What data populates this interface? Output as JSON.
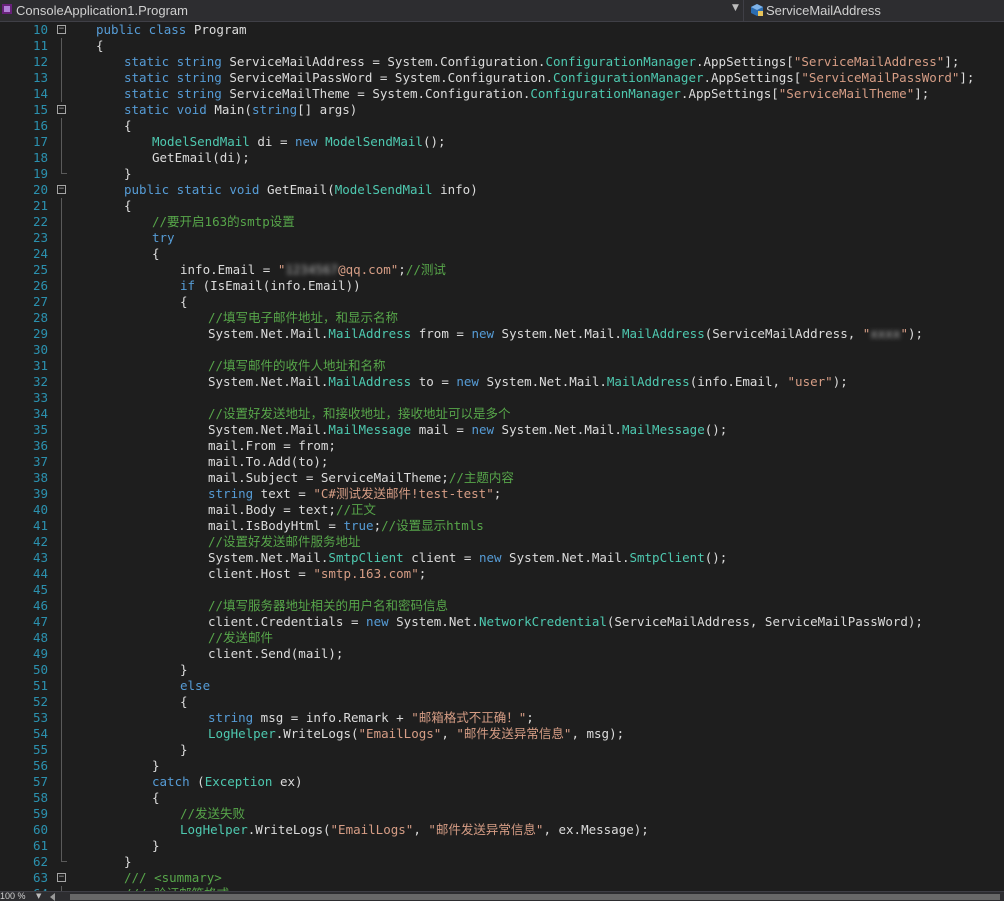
{
  "navigation_bar": {
    "type_selector": "ConsoleApplication1.Program",
    "member_selector": "ServiceMailAddress"
  },
  "status_bar": {
    "zoom": "100 %"
  },
  "colors": {
    "keyword": "#569cd6",
    "type": "#4ec9b0",
    "string": "#d69d85",
    "comment": "#57a64a",
    "line_number": "#2b91af",
    "text": "#dcdcdc",
    "background": "#1e1e1e"
  },
  "code_lines": [
    {
      "n": "10",
      "fold": "minus",
      "t": [
        [
          "kw",
          "public class"
        ],
        [
          "p",
          " Program"
        ]
      ]
    },
    {
      "n": "11",
      "fold": "line",
      "t": [
        [
          "p",
          "{"
        ]
      ]
    },
    {
      "n": "12",
      "fold": "line",
      "t": [
        [
          "kw",
          "static string"
        ],
        [
          "p",
          " ServiceMailAddress = System.Configuration."
        ],
        [
          "ty",
          "ConfigurationManager"
        ],
        [
          "p",
          ".AppSettings["
        ],
        [
          "str",
          "\"ServiceMailAddress\""
        ],
        [
          "p",
          "];"
        ]
      ]
    },
    {
      "n": "13",
      "fold": "line",
      "t": [
        [
          "kw",
          "static string"
        ],
        [
          "p",
          " ServiceMailPassWord = System.Configuration."
        ],
        [
          "ty",
          "ConfigurationManager"
        ],
        [
          "p",
          ".AppSettings["
        ],
        [
          "str",
          "\"ServiceMailPassWord\""
        ],
        [
          "p",
          "];"
        ]
      ]
    },
    {
      "n": "14",
      "fold": "line",
      "t": [
        [
          "kw",
          "static string"
        ],
        [
          "p",
          " ServiceMailTheme = System.Configuration."
        ],
        [
          "ty",
          "ConfigurationManager"
        ],
        [
          "p",
          ".AppSettings["
        ],
        [
          "str",
          "\"ServiceMailTheme\""
        ],
        [
          "p",
          "];"
        ]
      ]
    },
    {
      "n": "15",
      "fold": "minus",
      "t": [
        [
          "kw",
          "static void"
        ],
        [
          "p",
          " Main("
        ],
        [
          "kw",
          "string"
        ],
        [
          "p",
          "[] args)"
        ]
      ]
    },
    {
      "n": "16",
      "fold": "line",
      "t": [
        [
          "p",
          "{"
        ]
      ]
    },
    {
      "n": "17",
      "fold": "line",
      "t": [
        [
          "ty",
          "ModelSendMail"
        ],
        [
          "p",
          " di = "
        ],
        [
          "kw",
          "new"
        ],
        [
          "p",
          " "
        ],
        [
          "ty",
          "ModelSendMail"
        ],
        [
          "p",
          "();"
        ]
      ]
    },
    {
      "n": "18",
      "fold": "line",
      "t": [
        [
          "p",
          "GetEmail(di);"
        ]
      ]
    },
    {
      "n": "19",
      "fold": "end",
      "t": [
        [
          "p",
          "}"
        ]
      ]
    },
    {
      "n": "20",
      "fold": "minus",
      "t": [
        [
          "kw",
          "public static void"
        ],
        [
          "p",
          " GetEmail("
        ],
        [
          "ty",
          "ModelSendMail"
        ],
        [
          "p",
          " info)"
        ]
      ]
    },
    {
      "n": "21",
      "fold": "line",
      "t": [
        [
          "p",
          "{"
        ]
      ]
    },
    {
      "n": "22",
      "fold": "line",
      "t": [
        [
          "cm",
          "//要开启163的smtp设置"
        ]
      ]
    },
    {
      "n": "23",
      "fold": "line",
      "t": [
        [
          "kw",
          "try"
        ]
      ]
    },
    {
      "n": "24",
      "fold": "line",
      "t": [
        [
          "p",
          "{"
        ]
      ]
    },
    {
      "n": "25",
      "fold": "line",
      "t": [
        [
          "p",
          "info.Email = "
        ],
        [
          "str",
          "\""
        ],
        [
          "blur",
          "1234567"
        ],
        [
          "str",
          "@qq.com\""
        ],
        [
          "p",
          ";"
        ],
        [
          "cm",
          "//测试"
        ]
      ]
    },
    {
      "n": "26",
      "fold": "line",
      "t": [
        [
          "kw",
          "if"
        ],
        [
          "p",
          " (IsEmail(info.Email))"
        ]
      ]
    },
    {
      "n": "27",
      "fold": "line",
      "t": [
        [
          "p",
          "{"
        ]
      ]
    },
    {
      "n": "28",
      "fold": "line",
      "t": [
        [
          "cm",
          "//填写电子邮件地址，和显示名称"
        ]
      ]
    },
    {
      "n": "29",
      "fold": "line",
      "t": [
        [
          "p",
          "System.Net.Mail."
        ],
        [
          "ty",
          "MailAddress"
        ],
        [
          "p",
          " from = "
        ],
        [
          "kw",
          "new"
        ],
        [
          "p",
          " System.Net.Mail."
        ],
        [
          "ty",
          "MailAddress"
        ],
        [
          "p",
          "(ServiceMailAddress, "
        ],
        [
          "str",
          "\""
        ],
        [
          "blur",
          "xxxx"
        ],
        [
          "str",
          "\""
        ],
        [
          "p",
          ");"
        ]
      ]
    },
    {
      "n": "30",
      "fold": "line",
      "t": []
    },
    {
      "n": "31",
      "fold": "line",
      "t": [
        [
          "cm",
          "//填写邮件的收件人地址和名称"
        ]
      ]
    },
    {
      "n": "32",
      "fold": "line",
      "t": [
        [
          "p",
          "System.Net.Mail."
        ],
        [
          "ty",
          "MailAddress"
        ],
        [
          "p",
          " to = "
        ],
        [
          "kw",
          "new"
        ],
        [
          "p",
          " System.Net.Mail."
        ],
        [
          "ty",
          "MailAddress"
        ],
        [
          "p",
          "(info.Email, "
        ],
        [
          "str",
          "\"user\""
        ],
        [
          "p",
          ");"
        ]
      ]
    },
    {
      "n": "33",
      "fold": "line",
      "t": []
    },
    {
      "n": "34",
      "fold": "line",
      "t": [
        [
          "cm",
          "//设置好发送地址，和接收地址，接收地址可以是多个"
        ]
      ]
    },
    {
      "n": "35",
      "fold": "line",
      "t": [
        [
          "p",
          "System.Net.Mail."
        ],
        [
          "ty",
          "MailMessage"
        ],
        [
          "p",
          " mail = "
        ],
        [
          "kw",
          "new"
        ],
        [
          "p",
          " System.Net.Mail."
        ],
        [
          "ty",
          "MailMessage"
        ],
        [
          "p",
          "();"
        ]
      ]
    },
    {
      "n": "36",
      "fold": "line",
      "t": [
        [
          "p",
          "mail.From = from;"
        ]
      ]
    },
    {
      "n": "37",
      "fold": "line",
      "t": [
        [
          "p",
          "mail.To.Add(to);"
        ]
      ]
    },
    {
      "n": "38",
      "fold": "line",
      "t": [
        [
          "p",
          "mail.Subject = ServiceMailTheme;"
        ],
        [
          "cm",
          "//主题内容"
        ]
      ]
    },
    {
      "n": "39",
      "fold": "line",
      "t": [
        [
          "kw",
          "string"
        ],
        [
          "p",
          " text = "
        ],
        [
          "str",
          "\"C#测试发送邮件!test-test\""
        ],
        [
          "p",
          ";"
        ]
      ]
    },
    {
      "n": "40",
      "fold": "line",
      "t": [
        [
          "p",
          "mail.Body = text;"
        ],
        [
          "cm",
          "//正文"
        ]
      ]
    },
    {
      "n": "41",
      "fold": "line",
      "t": [
        [
          "p",
          "mail.IsBodyHtml = "
        ],
        [
          "kw",
          "true"
        ],
        [
          "p",
          ";"
        ],
        [
          "cm",
          "//设置显示htmls"
        ]
      ]
    },
    {
      "n": "42",
      "fold": "line",
      "t": [
        [
          "cm",
          "//设置好发送邮件服务地址"
        ]
      ]
    },
    {
      "n": "43",
      "fold": "line",
      "t": [
        [
          "p",
          "System.Net.Mail."
        ],
        [
          "ty",
          "SmtpClient"
        ],
        [
          "p",
          " client = "
        ],
        [
          "kw",
          "new"
        ],
        [
          "p",
          " System.Net.Mail."
        ],
        [
          "ty",
          "SmtpClient"
        ],
        [
          "p",
          "();"
        ]
      ]
    },
    {
      "n": "44",
      "fold": "line",
      "t": [
        [
          "p",
          "client.Host = "
        ],
        [
          "str",
          "\"smtp.163.com\""
        ],
        [
          "p",
          ";"
        ]
      ]
    },
    {
      "n": "45",
      "fold": "line",
      "t": []
    },
    {
      "n": "46",
      "fold": "line",
      "t": [
        [
          "cm",
          "//填写服务器地址相关的用户名和密码信息"
        ]
      ]
    },
    {
      "n": "47",
      "fold": "line",
      "t": [
        [
          "p",
          "client.Credentials = "
        ],
        [
          "kw",
          "new"
        ],
        [
          "p",
          " System.Net."
        ],
        [
          "ty",
          "NetworkCredential"
        ],
        [
          "p",
          "(ServiceMailAddress, ServiceMailPassWord);"
        ]
      ]
    },
    {
      "n": "48",
      "fold": "line",
      "t": [
        [
          "cm",
          "//发送邮件"
        ]
      ]
    },
    {
      "n": "49",
      "fold": "line",
      "t": [
        [
          "p",
          "client.Send(mail);"
        ]
      ]
    },
    {
      "n": "50",
      "fold": "line",
      "t": [
        [
          "p",
          "}"
        ]
      ]
    },
    {
      "n": "51",
      "fold": "line",
      "t": [
        [
          "kw",
          "else"
        ]
      ]
    },
    {
      "n": "52",
      "fold": "line",
      "t": [
        [
          "p",
          "{"
        ]
      ]
    },
    {
      "n": "53",
      "fold": "line",
      "t": [
        [
          "kw",
          "string"
        ],
        [
          "p",
          " msg = info.Remark + "
        ],
        [
          "str",
          "\"邮箱格式不正确！\""
        ],
        [
          "p",
          ";"
        ]
      ]
    },
    {
      "n": "54",
      "fold": "line",
      "t": [
        [
          "ty",
          "LogHelper"
        ],
        [
          "p",
          ".WriteLogs("
        ],
        [
          "str",
          "\"EmailLogs\""
        ],
        [
          "p",
          ", "
        ],
        [
          "str",
          "\"邮件发送异常信息\""
        ],
        [
          "p",
          ", msg);"
        ]
      ]
    },
    {
      "n": "55",
      "fold": "line",
      "t": [
        [
          "p",
          "}"
        ]
      ]
    },
    {
      "n": "56",
      "fold": "line",
      "t": [
        [
          "p",
          "}"
        ]
      ]
    },
    {
      "n": "57",
      "fold": "line",
      "t": [
        [
          "kw",
          "catch"
        ],
        [
          "p",
          " ("
        ],
        [
          "ty",
          "Exception"
        ],
        [
          "p",
          " ex)"
        ]
      ]
    },
    {
      "n": "58",
      "fold": "line",
      "t": [
        [
          "p",
          "{"
        ]
      ]
    },
    {
      "n": "59",
      "fold": "line",
      "t": [
        [
          "cm",
          "//发送失败"
        ]
      ]
    },
    {
      "n": "60",
      "fold": "line",
      "t": [
        [
          "ty",
          "LogHelper"
        ],
        [
          "p",
          ".WriteLogs("
        ],
        [
          "str",
          "\"EmailLogs\""
        ],
        [
          "p",
          ", "
        ],
        [
          "str",
          "\"邮件发送异常信息\""
        ],
        [
          "p",
          ", ex.Message);"
        ]
      ]
    },
    {
      "n": "61",
      "fold": "line",
      "t": [
        [
          "p",
          "}"
        ]
      ]
    },
    {
      "n": "62",
      "fold": "end",
      "t": [
        [
          "p",
          "}"
        ]
      ]
    },
    {
      "n": "63",
      "fold": "minus",
      "t": [
        [
          "cm",
          "/// <summary>"
        ]
      ]
    },
    {
      "n": "64",
      "fold": "line",
      "t": [
        [
          "cm",
          "/// 验证邮箱格式"
        ]
      ]
    }
  ]
}
